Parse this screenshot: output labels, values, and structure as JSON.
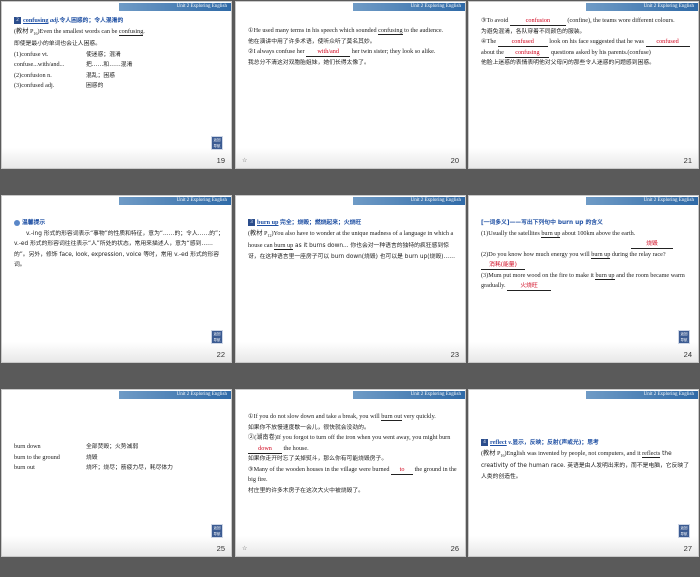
{
  "unit_label": "Unit 2 Exploring English",
  "nav_label": [
    "返回",
    "导航"
  ],
  "slides": [
    {
      "page": "19",
      "head_num": "2",
      "head_word": "confusing",
      "head_pos": "adj.",
      "head_def": "令人困惑的；令人混淆的",
      "lines": [
        {
          "pre": "(教材 P",
          "sub": "16",
          "mid": ")Even the smallest words can be ",
          "u": "confusing",
          "post": "."
        },
        {
          "text": "即使是最小的单词也会让人困惑。"
        }
      ],
      "pairs": [
        {
          "l": "(1)confuse vt.",
          "r": "使迷惑；混淆"
        },
        {
          "l": "confuse...with/and...",
          "r": "把……和……混淆"
        },
        {
          "l": "(2)confusion n.",
          "r": "混乱；困惑"
        },
        {
          "l": "(3)confused adj.",
          "r": "困惑的"
        }
      ]
    },
    {
      "page": "20",
      "items": [
        {
          "num": "①",
          "a": "He used many terms in his speech which sounded ",
          "u": "confusing",
          "b": " to the audience."
        },
        {
          "zh": "他在演讲中用了许多术语，使听众听了莫名其妙。"
        },
        {
          "num": "②",
          "a": "I always confuse her ",
          "ans": "with/and",
          "b": " her twin sister; they look so alike."
        },
        {
          "zh": "我总分不清这对双胞胎姐妹，她们长得太像了。"
        }
      ]
    },
    {
      "page": "21",
      "items": [
        {
          "num": "③",
          "a": "To avoid ",
          "ans": "confusion",
          "b": " (confine), the teams wore different colours."
        },
        {
          "zh": "为避免混淆，各队穿着不同颜色的服装。"
        },
        {
          "num": "④",
          "a": "The ",
          "ans": "confused",
          "b": " look on his face suggested that he was ",
          "ans2": "confused",
          "c": " about the ",
          "ans3": "confusing",
          "d": " questions asked by his parents.(confuse)"
        },
        {
          "zh": "他脸上迷惑的表情表明他对父母问的那些令人迷惑的问题感到困惑。"
        }
      ]
    },
    {
      "page": "22",
      "tip_title": "温馨提示",
      "tip_text": "v.-ing 形式的形容词表示“事物”的性质和特征，意为“……的；令人……的”；v.-ed 形式的形容词往往表示“人”所处的状态，常用来描述人，意为“感到……的”。另外，修饰 face, look, expression, voice 等时，常用 v.-ed 形式的形容词。"
    },
    {
      "page": "23",
      "head_num": "3",
      "head_word": "burn up",
      "head_def": "完全；烧毁；燃烧起来；火烧旺",
      "lines": [
        {
          "pre": "(教材 P",
          "sub": "12",
          "mid": ")You also have to wonder at the unique madness of a language in which a house can ",
          "u": "burn up",
          "post": " as it burns down...  你也会对一种语言的独特的疯狂感到惊讶，在这种语言里一座房子可以 burn down(烧毁) 也可以是 burn up(烧毁)……"
        }
      ]
    },
    {
      "page": "24",
      "title": "[一词多义]——写出下列句中 burn up 的含义",
      "items": [
        {
          "a": "(1)Usually the satellites ",
          "u": "burn up",
          "b": " about 100km above the earth.",
          "ans": "烧毁"
        },
        {
          "a": "(2)Do you know how much energy you will ",
          "u": "burn up",
          "b": " during the relay race?",
          "ans": "消耗(能量)"
        },
        {
          "a": "(3)Mum put more wood on the fire to make it ",
          "u": "burn up",
          "b": " and the room became warm gradually.",
          "ans": "火烧旺"
        }
      ]
    },
    {
      "page": "25",
      "pairs": [
        {
          "l": "burn down",
          "r": "全部焚毁；火势减弱"
        },
        {
          "l": "burn to the ground",
          "r": "烧毁"
        },
        {
          "l": "burn out",
          "r": "烧坏；烧尽；筋疲力尽，耗尽体力"
        }
      ]
    },
    {
      "page": "26",
      "items": [
        {
          "num": "①",
          "a": "If you do not slow down and take a break, you will ",
          "u": "burn out",
          "b": " very quickly."
        },
        {
          "zh": "如果你不放慢速度歇一会儿，很快就会没劲的。"
        },
        {
          "num": "②",
          "a": "(湖南卷)If you forgot to turn off the iron when you went away, you might burn ",
          "ans": "down",
          "b": " the house."
        },
        {
          "zh": "如果你走开时忘了关掉熨斗，那么你有可能烧毁房子。"
        },
        {
          "num": "③",
          "a": "Many of the wooden houses in the village were burned ",
          "ans": "to",
          "b": " the ground in the big fire."
        },
        {
          "zh": "村庄里的许多木房子在这次大火中被烧毁了。"
        }
      ]
    },
    {
      "page": "27",
      "head_num": "4",
      "head_word": "reflect",
      "head_pos": "v.",
      "head_def": "显示，反映；反射(声或光)；思考",
      "lines": [
        {
          "pre": "(教材 P",
          "sub": "16",
          "mid": ")English was invented by people, not computers, and it ",
          "u": "reflects",
          "post": " the creativity of the human race.  英语是由人发明出来的，而不是电脑，它反映了人类的创造性。"
        }
      ]
    }
  ]
}
